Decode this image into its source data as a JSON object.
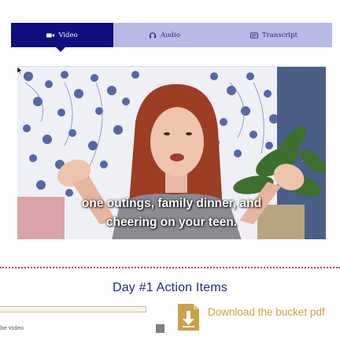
{
  "tabs": [
    {
      "label": "Video",
      "icon": "video-camera-icon",
      "active": true
    },
    {
      "label": "Audio",
      "icon": "headphones-icon",
      "active": false
    },
    {
      "label": "Transcript",
      "icon": "transcript-icon",
      "active": false
    }
  ],
  "video": {
    "subtitle_line1": "one outings, family dinner, and",
    "subtitle_line2": "cheering on your teen."
  },
  "section": {
    "heading": "Day #1 Action Items"
  },
  "left_partial": {
    "caption": "he video"
  },
  "download": {
    "label": "Download the bucket pdf",
    "icon": "download-file-icon"
  },
  "colors": {
    "tab_active": "#0f0f7d",
    "tab_inactive": "#b7b9e6",
    "heading": "#1f2a7a",
    "download": "#c8a24a",
    "divider": "#b5495b"
  }
}
